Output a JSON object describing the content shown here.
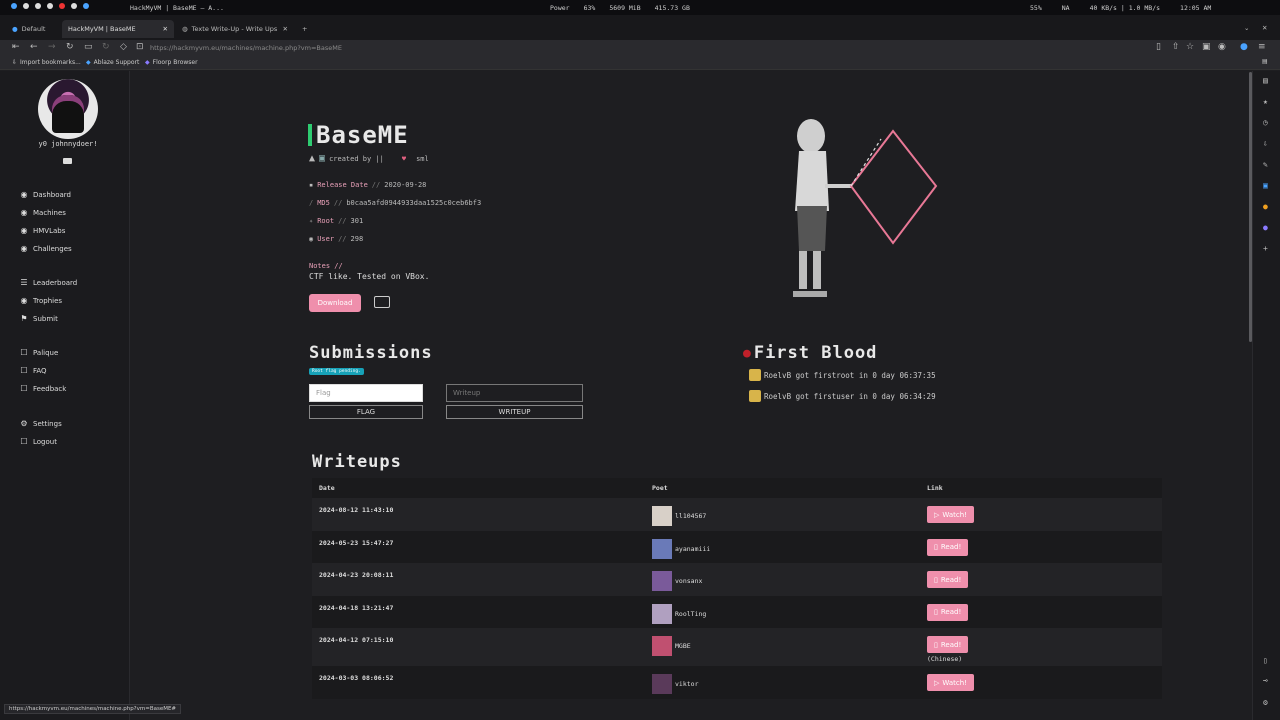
{
  "os": {
    "window_title": "HackMyVM | BaseME — A...",
    "power": "Power",
    "cpu": "63%",
    "mem": "5609 MiB",
    "disk": "415.73 GB",
    "battery": "55%",
    "wifi": "NA",
    "net": "40 KB/s | 1.0 MB/s",
    "clock": "12:05 AM"
  },
  "browser": {
    "tabs": [
      {
        "label": "Default"
      },
      {
        "label": "HackMyVM | BaseME"
      },
      {
        "label": "Texte Write-Up - Write Ups"
      }
    ],
    "url": "https://hackmyvm.eu/machines/machine.php?vm=BaseME",
    "bookmarks": [
      "Import bookmarks...",
      "Ablaze Support",
      "Floorp Browser"
    ],
    "status_url": "https://hackmyvm.eu/machines/machine.php?vm=BaseME#"
  },
  "sidebar": {
    "username": "y0 johnnydoer!",
    "groups": [
      [
        {
          "icon": "◉",
          "label": "Dashboard"
        },
        {
          "icon": "◉",
          "label": "Machines"
        },
        {
          "icon": "◉",
          "label": "HMVLabs"
        },
        {
          "icon": "◉",
          "label": "Challenges"
        }
      ],
      [
        {
          "icon": "☰",
          "label": "Leaderboard"
        },
        {
          "icon": "◉",
          "label": "Trophies"
        },
        {
          "icon": "⚑",
          "label": "Submit"
        }
      ],
      [
        {
          "icon": "☐",
          "label": "Palique"
        },
        {
          "icon": "☐",
          "label": "FAQ"
        },
        {
          "icon": "☐",
          "label": "Feedback"
        }
      ],
      [
        {
          "icon": "⚙",
          "label": "Settings"
        },
        {
          "icon": "☐",
          "label": "Logout"
        }
      ]
    ]
  },
  "machine": {
    "name": "BaseME",
    "created_by": "created by ||",
    "author": "sml",
    "release_label": "Release Date",
    "release_date": "2020-09-28",
    "md5_label": "MD5",
    "md5": "b0caa5afd0944933daa1525c0ceb6bf3",
    "root_label": "Root",
    "root_count": "301",
    "user_label": "User",
    "user_count": "298",
    "notes_label": "Notes //",
    "notes": "CTF like. Tested on VBox.",
    "download_label": "Download"
  },
  "submissions": {
    "title": "Submissions",
    "badge": "Root flag pending.",
    "flag_placeholder": "Flag",
    "flag_button": "FLAG",
    "writeup_placeholder": "Writeup",
    "writeup_button": "WRITEUP"
  },
  "first_blood": {
    "title": "First Blood",
    "entries": [
      "RoelvB got firstroot in 0 day 06:37:35",
      "RoelvB got firstuser in 0 day 06:34:29"
    ]
  },
  "writeups": {
    "title": "Writeups",
    "headers": [
      "Date",
      "Poet",
      "Link"
    ],
    "rows": [
      {
        "date": "2024-08-12 11:43:10",
        "poet": "ll104567",
        "link": "Watch!",
        "note": ""
      },
      {
        "date": "2024-05-23 15:47:27",
        "poet": "ayanamiii",
        "link": "Read!",
        "note": ""
      },
      {
        "date": "2024-04-23 20:08:11",
        "poet": "vonsanx",
        "link": "Read!",
        "note": ""
      },
      {
        "date": "2024-04-18 13:21:47",
        "poet": "RoolTing",
        "link": "Read!",
        "note": ""
      },
      {
        "date": "2024-04-12 07:15:10",
        "poet": "MGBE",
        "link": "Read!",
        "note": "(Chinese)"
      },
      {
        "date": "2024-03-03 08:06:52",
        "poet": "viktor",
        "link": "Watch!",
        "note": ""
      }
    ]
  }
}
